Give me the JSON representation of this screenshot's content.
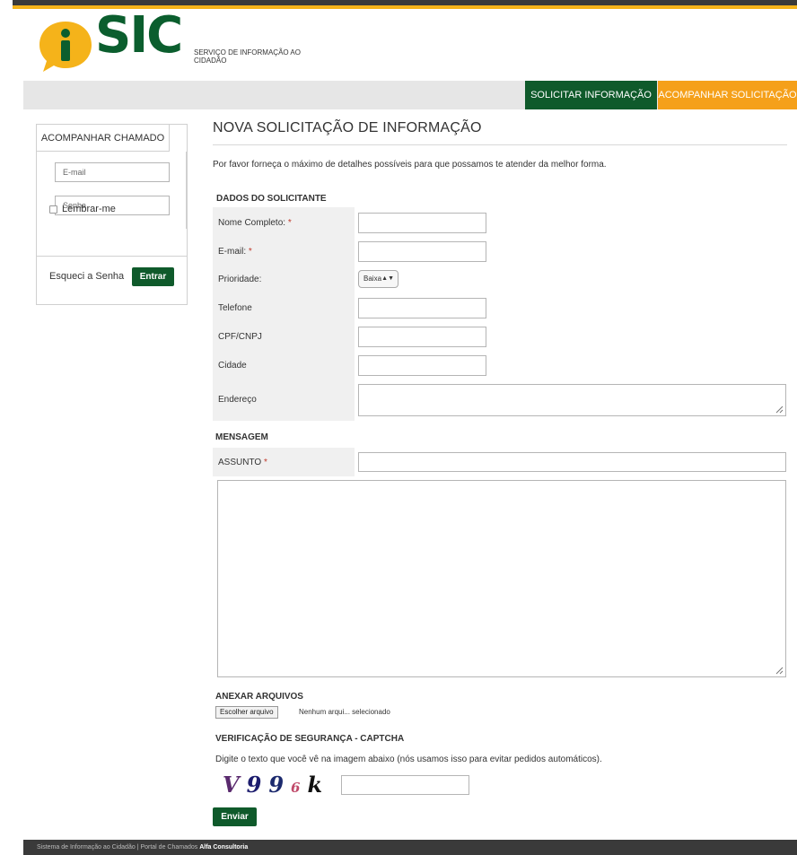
{
  "brand": {
    "logo_text": "SIC",
    "subtitle": "SERVIÇO DE INFORMAÇÃO AO CIDADÃO",
    "colors": {
      "green": "#0f5a2b",
      "orange": "#f5a01a",
      "yellow": "#f5b31a"
    }
  },
  "nav": {
    "solicitar": "SOLICITAR INFORMAÇÃO",
    "acompanhar": "ACOMPANHAR SOLICITAÇÃO"
  },
  "sidebar": {
    "tab": "ACOMPANHAR CHAMADO",
    "email_placeholder": "E-mail",
    "senha_placeholder": "Senha",
    "remember": "Lembrar-me",
    "forgot": "Esqueci a Senha",
    "login_button": "Entrar"
  },
  "form": {
    "title": "NOVA SOLICITAÇÃO DE INFORMAÇÃO",
    "intro": "Por favor forneça o máximo de detalhes possíveis para que possamos te atender da melhor forma.",
    "section_dados": "DADOS DO SOLICITANTE",
    "fields": {
      "nome": "Nome Completo:",
      "email": "E-mail:",
      "prioridade": "Prioridade:",
      "prioridade_value": "Baixa",
      "telefone": "Telefone",
      "cpf": "CPF/CNPJ",
      "cidade": "Cidade",
      "endereco": "Endereço"
    },
    "required_mark": "*",
    "section_mensagem": "MENSAGEM",
    "assunto": "ASSUNTO",
    "section_anexar": "ANEXAR ARQUIVOS",
    "file_button": "Escolher arquivo",
    "file_status": "Nenhum arqui... selecionado",
    "section_captcha": "VERIFICAÇÃO DE SEGURANÇA - CAPTCHA",
    "captcha_instruction": "Digite o texto que você vê na imagem abaixo (nós usamos isso para evitar pedidos automáticos).",
    "captcha_chars": [
      {
        "char": "V",
        "color": "#5a2a6e"
      },
      {
        "char": "9",
        "color": "#1c1c6e"
      },
      {
        "char": "9",
        "color": "#1c2a6e"
      },
      {
        "char": "6",
        "color": "#c04a6a"
      },
      {
        "char": "k",
        "color": "#111111"
      }
    ],
    "submit": "Enviar"
  },
  "footer": {
    "text": "Sistema de Informação ao Cidadão | Portal de Chamados ",
    "company": "Alfa Consultoria"
  }
}
